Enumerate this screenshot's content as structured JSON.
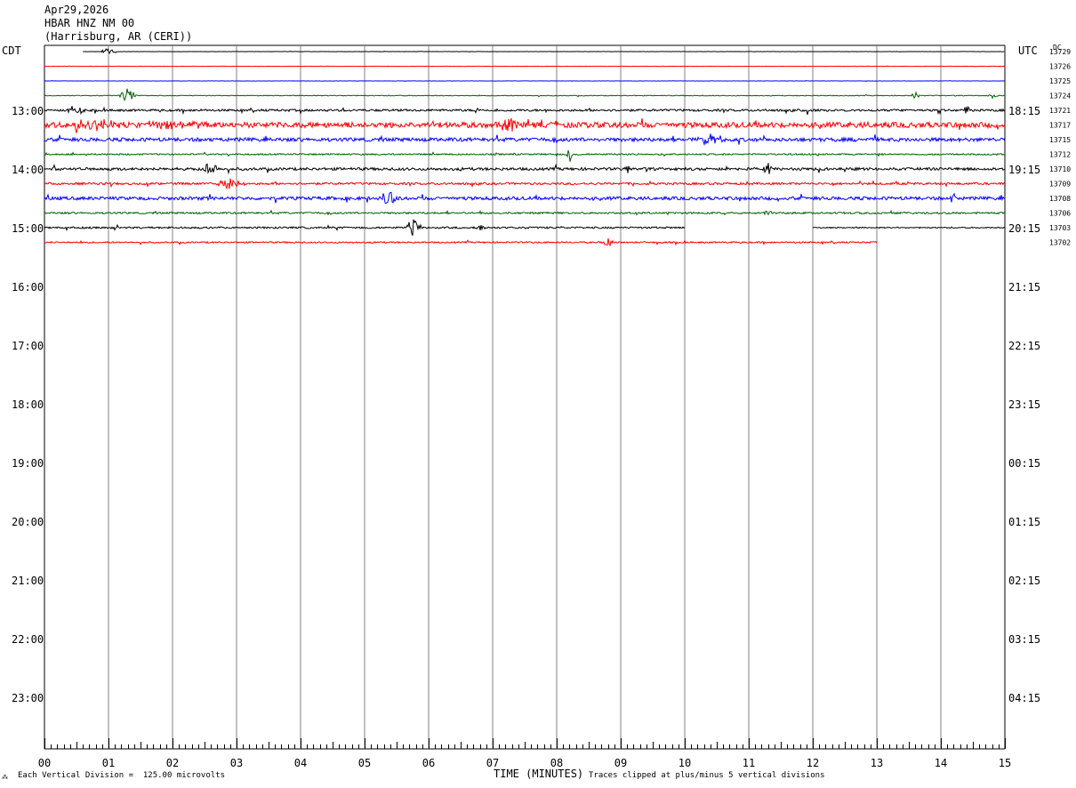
{
  "header": {
    "date": "Apr29,2026",
    "station": "HBAR HNZ NM 00",
    "location": "(Harrisburg, AR (CERI))"
  },
  "left_tz": "CDT",
  "right_tz": "UTC",
  "dc_label": "DC",
  "footer": {
    "scale": "Each Vertical Division =  125.00 microvolts",
    "xlabel": "TIME (MINUTES)",
    "clip_note": "Traces clipped at plus/minus 5 vertical divisions"
  },
  "colors": {
    "black": "#000000",
    "red": "#ff0000",
    "blue": "#0000ff",
    "green": "#006400",
    "grid": "#808080"
  },
  "chart_data": {
    "type": "line",
    "title": "HBAR HNZ NM 00",
    "xlabel": "TIME (MINUTES)",
    "xlim": [
      0,
      15
    ],
    "x_ticks": [
      "00",
      "01",
      "02",
      "03",
      "04",
      "05",
      "06",
      "07",
      "08",
      "09",
      "10",
      "11",
      "12",
      "13",
      "14",
      "15"
    ],
    "left_hour_labels": [
      {
        "label": "13:00",
        "row": 4
      },
      {
        "label": "14:00",
        "row": 8
      },
      {
        "label": "15:00",
        "row": 12
      },
      {
        "label": "16:00",
        "row": 16
      },
      {
        "label": "17:00",
        "row": 20
      },
      {
        "label": "18:00",
        "row": 24
      },
      {
        "label": "19:00",
        "row": 28
      },
      {
        "label": "20:00",
        "row": 32
      },
      {
        "label": "21:00",
        "row": 36
      },
      {
        "label": "22:00",
        "row": 40
      },
      {
        "label": "23:00",
        "row": 44
      }
    ],
    "right_hour_labels": [
      {
        "label": "18:15",
        "row": 4
      },
      {
        "label": "19:15",
        "row": 8
      },
      {
        "label": "20:15",
        "row": 12
      },
      {
        "label": "21:15",
        "row": 16
      },
      {
        "label": "22:15",
        "row": 20
      },
      {
        "label": "23:15",
        "row": 24
      },
      {
        "label": "00:15",
        "row": 28
      },
      {
        "label": "01:15",
        "row": 32
      },
      {
        "label": "02:15",
        "row": 36
      },
      {
        "label": "03:15",
        "row": 40
      },
      {
        "label": "04:15",
        "row": 44
      }
    ],
    "traces": [
      {
        "row": 0,
        "dc": "13729",
        "color": "black",
        "start": 0.6,
        "end": 15,
        "noise": 0.15,
        "events": [
          {
            "t": 1.0,
            "amp": 5,
            "w": 0.15
          }
        ]
      },
      {
        "row": 1,
        "dc": "13726",
        "color": "red",
        "start": 0,
        "end": 15,
        "noise": 0.15,
        "events": []
      },
      {
        "row": 2,
        "dc": "13725",
        "color": "blue",
        "start": 0,
        "end": 15,
        "noise": 0.15,
        "events": []
      },
      {
        "row": 3,
        "dc": "13724",
        "color": "green",
        "start": 0,
        "end": 15,
        "noise": 0.4,
        "events": [
          {
            "t": 1.3,
            "amp": 10,
            "w": 0.15
          },
          {
            "t": 13.6,
            "amp": 4,
            "w": 0.08
          },
          {
            "t": 14.8,
            "amp": 3,
            "w": 0.1
          }
        ]
      },
      {
        "row": 4,
        "dc": "13721",
        "color": "black",
        "start": 0,
        "end": 15,
        "noise": 1.2,
        "events": [
          {
            "t": 0.5,
            "amp": 6,
            "w": 0.2
          },
          {
            "t": 11.9,
            "amp": 6,
            "w": 0.05
          },
          {
            "t": 14.4,
            "amp": 6,
            "w": 0.06
          }
        ]
      },
      {
        "row": 5,
        "dc": "13717",
        "color": "red",
        "start": 0,
        "end": 15,
        "noise": 3.0,
        "events": [
          {
            "t": 0.8,
            "amp": 7,
            "w": 0.6
          },
          {
            "t": 2.0,
            "amp": 6,
            "w": 0.6
          },
          {
            "t": 7.2,
            "amp": 7,
            "w": 0.3
          }
        ]
      },
      {
        "row": 6,
        "dc": "13715",
        "color": "blue",
        "start": 0,
        "end": 15,
        "noise": 2.0,
        "events": [
          {
            "t": 10.4,
            "amp": 6,
            "w": 0.3
          }
        ]
      },
      {
        "row": 7,
        "dc": "13712",
        "color": "green",
        "start": 0,
        "end": 15,
        "noise": 0.8,
        "events": [
          {
            "t": 8.2,
            "amp": 10,
            "w": 0.05
          }
        ]
      },
      {
        "row": 8,
        "dc": "13710",
        "color": "black",
        "start": 0,
        "end": 15,
        "noise": 1.5,
        "events": [
          {
            "t": 2.6,
            "amp": 12,
            "w": 0.12
          },
          {
            "t": 11.3,
            "amp": 8,
            "w": 0.08
          },
          {
            "t": 9.1,
            "amp": 6,
            "w": 0.05
          }
        ]
      },
      {
        "row": 9,
        "dc": "13709",
        "color": "red",
        "start": 0,
        "end": 15,
        "noise": 1.2,
        "events": [
          {
            "t": 2.9,
            "amp": 6,
            "w": 0.3
          }
        ]
      },
      {
        "row": 10,
        "dc": "13708",
        "color": "blue",
        "start": 0,
        "end": 15,
        "noise": 1.8,
        "events": [
          {
            "t": 5.4,
            "amp": 8,
            "w": 0.15
          },
          {
            "t": 14.2,
            "amp": 5,
            "w": 0.1
          }
        ]
      },
      {
        "row": 11,
        "dc": "13706",
        "color": "green",
        "start": 0,
        "end": 15,
        "noise": 1.0,
        "events": [
          {
            "t": 11.3,
            "amp": 4,
            "w": 0.1
          }
        ]
      },
      {
        "row": 12,
        "dc": "13703",
        "color": "black",
        "start": 0,
        "end": 10,
        "noise": 1.0,
        "events": [
          {
            "t": 5.75,
            "amp": 14,
            "w": 0.12
          },
          {
            "t": 6.8,
            "amp": 5,
            "w": 0.08
          }
        ]
      },
      {
        "row": 12,
        "dc": "",
        "color": "black",
        "start": 12,
        "end": 15,
        "noise": 0.6,
        "events": []
      },
      {
        "row": 13,
        "dc": "13702",
        "color": "red",
        "start": 0,
        "end": 13,
        "noise": 0.8,
        "events": [
          {
            "t": 8.8,
            "amp": 6,
            "w": 0.1
          }
        ]
      }
    ]
  }
}
